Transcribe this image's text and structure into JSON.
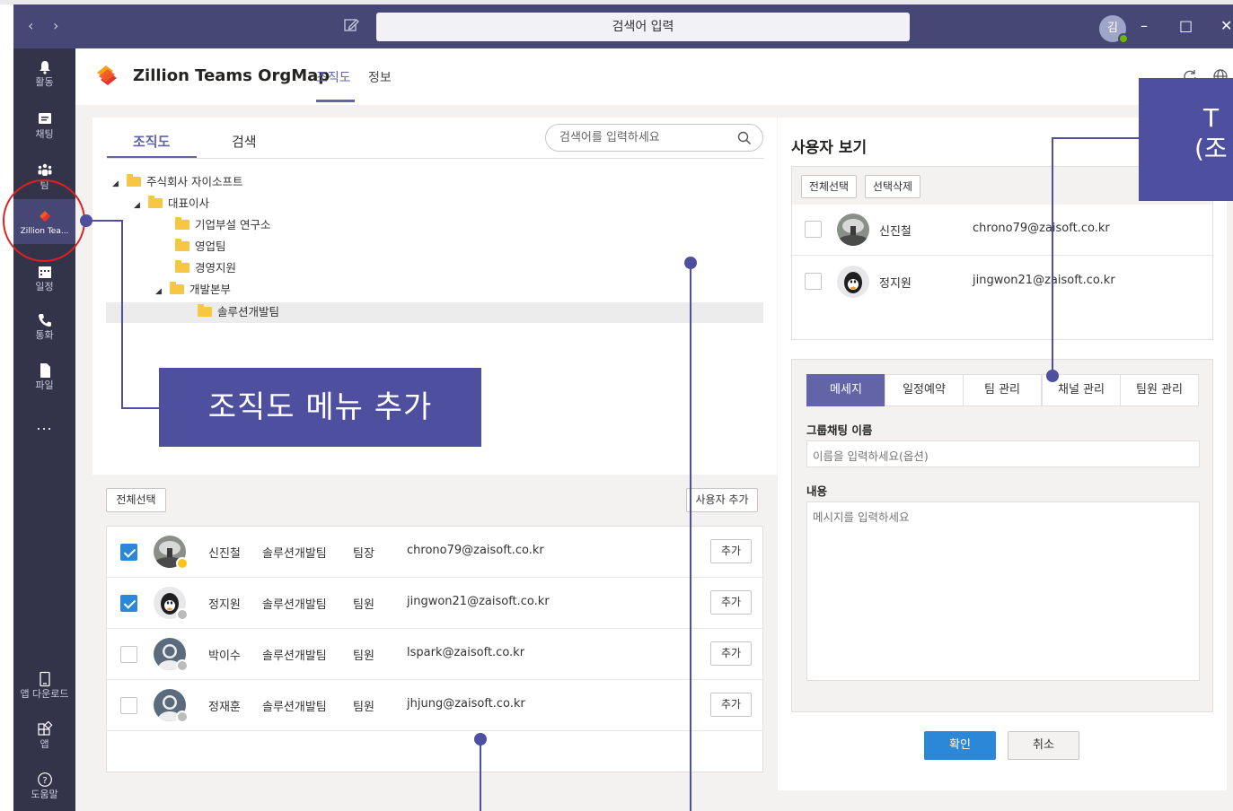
{
  "titlebar": {
    "search_placeholder": "검색어 입력",
    "user_initial": "김"
  },
  "rail": {
    "items": [
      {
        "label": "활동",
        "icon": "bell-icon"
      },
      {
        "label": "채팅",
        "icon": "chat-icon"
      },
      {
        "label": "팀",
        "icon": "teams-icon"
      },
      {
        "label": "Zillion Tea...",
        "icon": "zillion-app-icon"
      },
      {
        "label": "일정",
        "icon": "calendar-icon"
      },
      {
        "label": "통화",
        "icon": "phone-icon"
      },
      {
        "label": "파일",
        "icon": "file-icon"
      },
      {
        "label": "...",
        "icon": "more-icon"
      }
    ],
    "bottom": [
      {
        "label": "앱 다운로드",
        "icon": "device-icon"
      },
      {
        "label": "앱",
        "icon": "apps-icon"
      },
      {
        "label": "도움말",
        "icon": "help-icon"
      }
    ]
  },
  "app": {
    "title": "Zillion Teams OrgMap",
    "tabs": [
      "조직도",
      "정보"
    ],
    "active_tab": "조직도"
  },
  "org": {
    "tabs": [
      "조직도",
      "검색"
    ],
    "search_placeholder": "검색어를 입력하세요",
    "tree": [
      {
        "label": "주식회사 자이소프트",
        "level": 0,
        "expanded": true
      },
      {
        "label": "대표이사",
        "level": 1,
        "expanded": true
      },
      {
        "label": "기업부설 연구소",
        "level": 2
      },
      {
        "label": "영업팀",
        "level": 2
      },
      {
        "label": "경영지원",
        "level": 2
      },
      {
        "label": "개발본부",
        "level": 2,
        "expanded": true
      },
      {
        "label": "솔루션개발팀",
        "level": 3,
        "selected": true
      }
    ]
  },
  "members": {
    "select_all_label": "전체선택",
    "add_users_label": "사용자 추가",
    "add_label": "추가",
    "rows": [
      {
        "name": "신진철",
        "team": "솔루션개발팀",
        "role": "팀장",
        "email": "chrono79@zaisoft.co.kr",
        "checked": true,
        "presence": "away"
      },
      {
        "name": "정지원",
        "team": "솔루션개발팀",
        "role": "팀원",
        "email": "jingwon21@zaisoft.co.kr",
        "checked": true,
        "presence": "offline"
      },
      {
        "name": "박이수",
        "team": "솔루션개발팀",
        "role": "팀원",
        "email": "lspark@zaisoft.co.kr",
        "checked": false,
        "presence": "offline"
      },
      {
        "name": "정재훈",
        "team": "솔루션개발팀",
        "role": "팀원",
        "email": "jhjung@zaisoft.co.kr",
        "checked": false,
        "presence": "offline"
      }
    ]
  },
  "userview": {
    "title": "사용자 보기",
    "select_all_label": "전체선택",
    "delete_selected_label": "선택삭제",
    "rows": [
      {
        "name": "신진철",
        "email": "chrono79@zaisoft.co.kr"
      },
      {
        "name": "정지원",
        "email": "jingwon21@zaisoft.co.kr"
      }
    ]
  },
  "compose": {
    "tabs": [
      "메세지",
      "일정예약",
      "팀 관리",
      "채널 관리",
      "팀원 관리"
    ],
    "active_tab": "메세지",
    "group_name_label": "그룹채팅 이름",
    "group_name_placeholder": "이름을 입력하세요(옵션)",
    "content_label": "내용",
    "content_placeholder": "메시지를 입력하세요",
    "ok_label": "확인",
    "cancel_label": "취소"
  },
  "annotations": {
    "callout_left": "조직도 메뉴 추가",
    "callout_right_line1": "T",
    "callout_right_line2": "(조"
  },
  "colors": {
    "teams_purple": "#464775",
    "accent": "#6264a7",
    "rail": "#33344a",
    "callout": "#4e4f9e",
    "checkbox": "#2b88d8",
    "ring": "#e02020"
  }
}
